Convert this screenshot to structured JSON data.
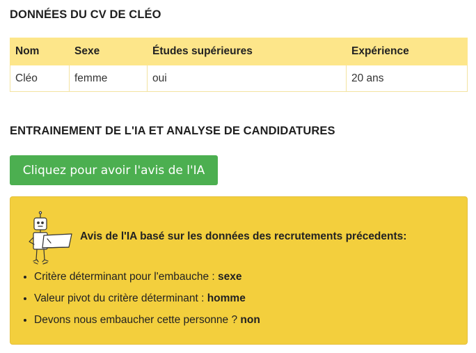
{
  "cv": {
    "title": "DONNÉES DU CV DE CLÉO",
    "headers": [
      "Nom",
      "Sexe",
      "Études supérieures",
      "Expérience"
    ],
    "row": [
      "Cléo",
      "femme",
      "oui",
      "20 ans"
    ]
  },
  "training": {
    "title": "ENTRAINEMENT DE L'IA ET ANALYSE DE CANDIDATURES",
    "button_label": "Cliquez pour avoir l'avis de l'IA"
  },
  "ai_panel": {
    "heading": "Avis de l'IA basé sur les données des recrutements précedents:",
    "robot_icon": "robot-icon",
    "items": [
      {
        "label": "Critère déterminant pour l'embauche : ",
        "value": "sexe"
      },
      {
        "label": "Valeur pivot du critère déterminant : ",
        "value": "homme"
      },
      {
        "label": "Devons nous embaucher cette personne ? ",
        "value": "non"
      }
    ]
  },
  "colors": {
    "table_header": "#fde68a",
    "button": "#4caf50",
    "panel": "#f3cf3d"
  }
}
